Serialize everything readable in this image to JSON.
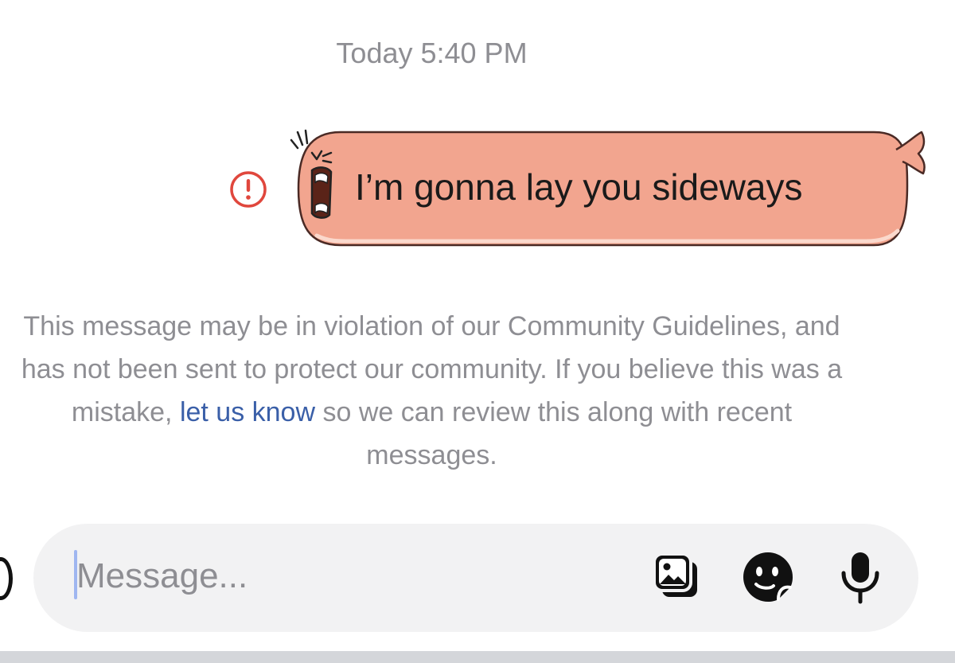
{
  "conversation": {
    "timestamp": "Today 5:40 PM"
  },
  "message": {
    "text": "I’m gonna lay you sideways",
    "status_icon": "error-exclamation-circle-icon",
    "sticker_icon": "shouting-can-sticker-icon",
    "bubble_color": "#f2a58f",
    "error_color": "#e0473d"
  },
  "notice": {
    "text_before": "This message may be in violation of our Community Guidelines, and has not been sent to protect our community. If you believe this was a mistake, ",
    "link_text": "let us know",
    "text_after": " so we can review this along with recent messages.",
    "link_color": "#3a5fa8"
  },
  "composer": {
    "placeholder": "Message...",
    "value": "",
    "icons": [
      "gallery-icon",
      "sticker-icon",
      "microphone-icon"
    ]
  }
}
